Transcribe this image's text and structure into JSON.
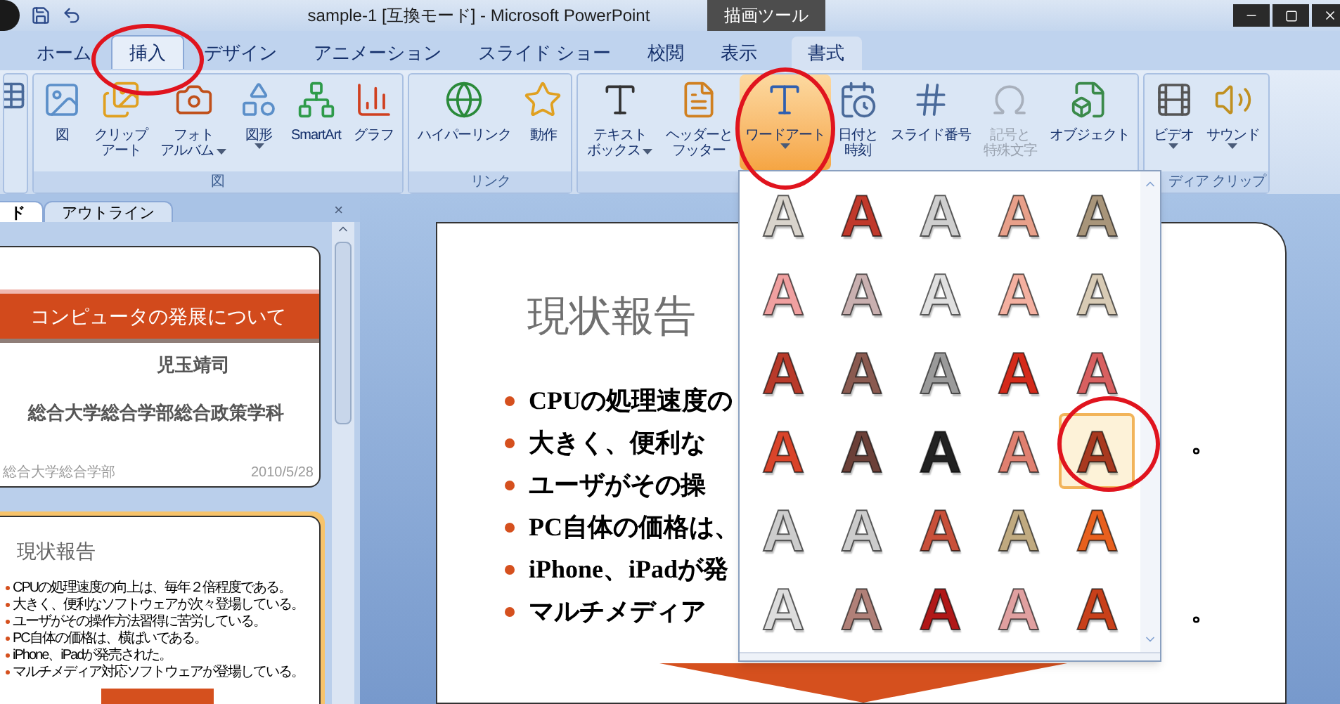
{
  "window": {
    "title": "sample-1 [互換モード] - Microsoft PowerPoint",
    "context_tab": "描画ツール"
  },
  "tabs": [
    {
      "label": "ホーム",
      "selected": false,
      "circled": false
    },
    {
      "label": "挿入",
      "selected": true,
      "circled": true
    },
    {
      "label": "デザイン",
      "selected": false,
      "circled": false
    },
    {
      "label": "アニメーション",
      "selected": false,
      "circled": false
    },
    {
      "label": "スライド ショー",
      "selected": false,
      "circled": false
    },
    {
      "label": "校閲",
      "selected": false,
      "circled": false
    },
    {
      "label": "表示",
      "selected": false,
      "circled": false
    },
    {
      "label": "書式",
      "selected": false,
      "circled": false
    }
  ],
  "ribbon": {
    "groups": [
      {
        "label": "図",
        "buttons": [
          {
            "lines": [
              "図"
            ],
            "menu": false,
            "disabled": false,
            "circled": false
          },
          {
            "lines": [
              "クリップ",
              "アート"
            ],
            "menu": false,
            "disabled": false,
            "circled": false
          },
          {
            "lines": [
              "フォト",
              "アルバム"
            ],
            "menu": true,
            "disabled": false,
            "circled": false
          },
          {
            "lines": [
              "図形"
            ],
            "menu": true,
            "disabled": false,
            "circled": false
          },
          {
            "lines": [
              "SmartArt"
            ],
            "menu": false,
            "disabled": false,
            "circled": false
          },
          {
            "lines": [
              "グラフ"
            ],
            "menu": false,
            "disabled": false,
            "circled": false
          }
        ]
      },
      {
        "label": "リンク",
        "buttons": [
          {
            "lines": [
              "ハイパーリンク"
            ],
            "menu": false,
            "disabled": false,
            "circled": false
          },
          {
            "lines": [
              "動作"
            ],
            "menu": false,
            "disabled": false,
            "circled": false
          }
        ]
      },
      {
        "buttons": [
          {
            "lines": [
              "テキスト",
              "ボックス"
            ],
            "menu": true,
            "disabled": false,
            "circled": false
          },
          {
            "lines": [
              "ヘッダーと",
              "フッター"
            ],
            "menu": false,
            "disabled": false,
            "circled": false
          },
          {
            "lines": [
              "ワードアート"
            ],
            "menu": true,
            "disabled": false,
            "circled": true
          },
          {
            "lines": [
              "日付と",
              "時刻"
            ],
            "menu": false,
            "disabled": false,
            "circled": false
          },
          {
            "lines": [
              "スライド番号"
            ],
            "menu": false,
            "disabled": false,
            "circled": false
          },
          {
            "lines": [
              "記号と",
              "特殊文字"
            ],
            "menu": false,
            "disabled": true,
            "circled": false
          },
          {
            "lines": [
              "オブジェクト"
            ],
            "menu": false,
            "disabled": false,
            "circled": false
          }
        ]
      },
      {
        "label": "ディア クリップ",
        "buttons": [
          {
            "lines": [
              "ビデオ"
            ],
            "menu": true,
            "disabled": false,
            "circled": false
          },
          {
            "lines": [
              "サウンド"
            ],
            "menu": true,
            "disabled": false,
            "circled": false
          }
        ]
      }
    ]
  },
  "pane": {
    "tabs": [
      {
        "label": "ド",
        "selected": true
      },
      {
        "label": "アウトライン",
        "selected": false
      }
    ],
    "close": "×",
    "thumbnails": [
      {
        "selected": false,
        "title": "コンピュータの発展について",
        "author": "児玉靖司",
        "affiliation": "総合大学総合学部総合政策学科",
        "footer": "総合大学総合学部",
        "date": "2010/5/28"
      },
      {
        "selected": true,
        "title": "現状報告",
        "bullets": [
          "CPUの処理速度の向上は、毎年２倍程度である。",
          "大きく、便利なソフトウェアが次々登場している。",
          "ユーザがその操作方法習得に苦労している。",
          "PC自体の価格は、横ばいである。",
          "iPhone、iPadが発売された。",
          "マルチメディア対応ソフトウェアが登場している。"
        ]
      }
    ]
  },
  "slide": {
    "title": "現状報告",
    "bullets": [
      {
        "text": "CPUの処理速度の"
      },
      {
        "text": "大きく、便利な",
        "tail": "。"
      },
      {
        "text": "ユーザがその操"
      },
      {
        "text": "PC自体の価格は、"
      },
      {
        "text": "iPhone、iPadが発"
      },
      {
        "text": "マルチメディア",
        "tail": "。"
      }
    ]
  },
  "gallery": {
    "items": [
      {
        "glyph": "A",
        "color": "#d9d4cc",
        "selected": false,
        "circled": false
      },
      {
        "glyph": "A",
        "color": "#c0392b",
        "selected": false,
        "circled": false
      },
      {
        "glyph": "A",
        "color": "#cfcfcf",
        "selected": false,
        "circled": false
      },
      {
        "glyph": "A",
        "color": "#e8a08a",
        "selected": false,
        "circled": false
      },
      {
        "glyph": "A",
        "color": "#a8957a",
        "selected": false,
        "circled": false
      },
      {
        "glyph": "A",
        "color": "#f0a0a0",
        "selected": false,
        "circled": false
      },
      {
        "glyph": "A",
        "color": "#c9b0b0",
        "selected": false,
        "circled": false
      },
      {
        "glyph": "A",
        "color": "#e0e0e0",
        "selected": false,
        "circled": false
      },
      {
        "glyph": "A",
        "color": "#f4b0a0",
        "selected": false,
        "circled": false
      },
      {
        "glyph": "A",
        "color": "#d8cbb5",
        "selected": false,
        "circled": false
      },
      {
        "glyph": "A",
        "color": "#b83a2a",
        "selected": false,
        "circled": false
      },
      {
        "glyph": "A",
        "color": "#8a5a50",
        "selected": false,
        "circled": false
      },
      {
        "glyph": "A",
        "color": "#9a9a9a",
        "selected": false,
        "circled": false
      },
      {
        "glyph": "A",
        "color": "#d42a1a",
        "selected": false,
        "circled": false
      },
      {
        "glyph": "A",
        "color": "#d86060",
        "selected": false,
        "circled": false
      },
      {
        "glyph": "A",
        "color": "#d9442a",
        "selected": false,
        "circled": false
      },
      {
        "glyph": "A",
        "color": "#6b4038",
        "selected": false,
        "circled": false
      },
      {
        "glyph": "A",
        "color": "#222222",
        "selected": false,
        "circled": false
      },
      {
        "glyph": "A",
        "color": "#e08070",
        "selected": false,
        "circled": false
      },
      {
        "glyph": "A",
        "color": "#a8391f",
        "selected": true,
        "circled": true
      },
      {
        "glyph": "A",
        "color": "#cdcdcd",
        "selected": false,
        "circled": false
      },
      {
        "glyph": "A",
        "color": "#cccccc",
        "selected": false,
        "circled": false
      },
      {
        "glyph": "A",
        "color": "#c8503a",
        "selected": false,
        "circled": false
      },
      {
        "glyph": "A",
        "color": "#c0aa80",
        "selected": false,
        "circled": false
      },
      {
        "glyph": "A",
        "color": "#e8601e",
        "selected": false,
        "circled": false
      },
      {
        "glyph": "A",
        "color": "#dddddd",
        "selected": false,
        "circled": false
      },
      {
        "glyph": "A",
        "color": "#b08078",
        "selected": false,
        "circled": false
      },
      {
        "glyph": "A",
        "color": "#b01818",
        "selected": false,
        "circled": false
      },
      {
        "glyph": "A",
        "color": "#e0a0a0",
        "selected": false,
        "circled": false
      },
      {
        "glyph": "A",
        "color": "#c8401a",
        "selected": false,
        "circled": false
      }
    ]
  }
}
